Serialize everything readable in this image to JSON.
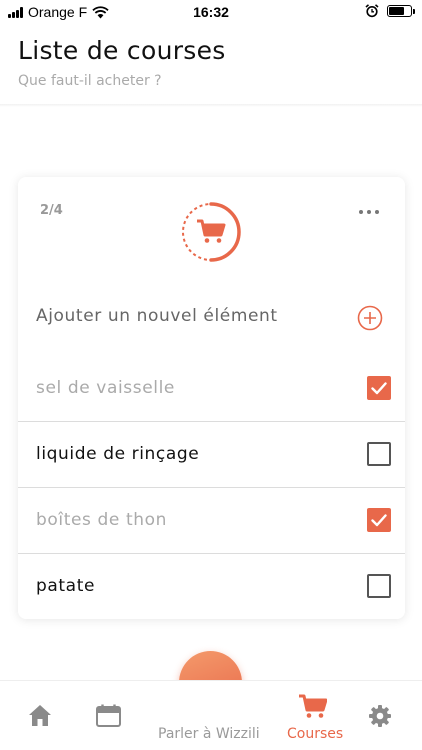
{
  "status_bar": {
    "carrier": "Orange F",
    "time": "16:32"
  },
  "header": {
    "title": "Liste de courses",
    "subtitle": "Que faut-il acheter ?"
  },
  "card": {
    "counter": "2/4",
    "progress_fraction": 0.5,
    "add_label": "Ajouter un nouvel élément",
    "items": [
      {
        "label": "sel de vaisselle",
        "checked": true
      },
      {
        "label": "liquide de rinçage",
        "checked": false
      },
      {
        "label": "boîtes de thon",
        "checked": true
      },
      {
        "label": "patate",
        "checked": false
      }
    ]
  },
  "nav": {
    "talk_label": "Parler à Wizzili",
    "courses_label": "Courses"
  },
  "colors": {
    "accent": "#e8684a",
    "muted": "#aaaaaa",
    "inactive_icon": "#8a8a8a"
  },
  "icons": [
    "signal-icon",
    "wifi-icon",
    "alarm-icon",
    "battery-icon",
    "cart-icon",
    "more-icon",
    "add-icon",
    "home-icon",
    "calendar-icon",
    "smile-icon",
    "gear-icon"
  ]
}
